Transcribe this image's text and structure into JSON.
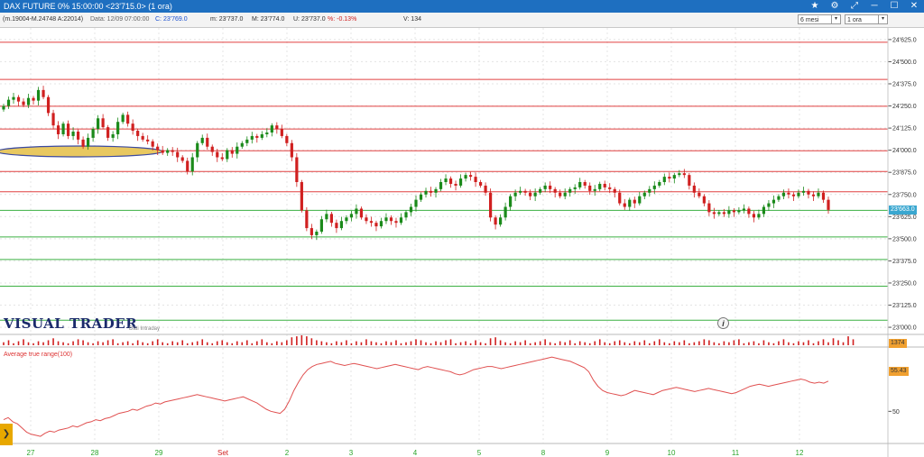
{
  "window": {
    "title": "DAX FUTURE 0%  15:00:00   <23'715.0>  (1 ora)",
    "buttons": [
      "★",
      "⚙",
      "⤢",
      "─",
      "☐",
      "✕"
    ]
  },
  "infobar": {
    "id": "(m.19004-M.24748 A:22014)",
    "data": "Data: 12/09 07:00:00",
    "close": "C: 23'769.0",
    "min": "m: 23'737.0",
    "max": "M: 23'774.0",
    "last": "U: 23'737.0",
    "pct": "%: -0.13%",
    "volume": "V: 134",
    "period": "6 mesi",
    "interval": "1 ora"
  },
  "brand": {
    "name": "VISUAL TRADER",
    "sub": "Dati Intraday"
  },
  "atr": {
    "label": "Average true range(100)",
    "value": "55.43",
    "tick": "50"
  },
  "volume_tag": "1374",
  "last_price_tag": "23'663.0",
  "colors": {
    "up": "#1a8a1a",
    "down": "#d02020",
    "resistance": "#e04040",
    "support": "#3cb043",
    "highlight": "#e8c860"
  },
  "chart_data": [
    {
      "type": "candlestick",
      "title": "DAX FUTURE 0%",
      "ylim": [
        22980,
        24660
      ],
      "y_ticks": [
        "24'625.0",
        "24'500.0",
        "24'375.0",
        "24'250.0",
        "24'125.0",
        "24'000.0",
        "23'875.0",
        "23'750.0",
        "23'625.0",
        "23'500.0",
        "23'375.0",
        "23'250.0",
        "23'125.0",
        "23'000.0"
      ],
      "x_labels": [
        "27",
        "28",
        "29",
        "Set",
        "2",
        "3",
        "4",
        "5",
        "8",
        "9",
        "10",
        "11",
        "12"
      ],
      "resistance_lines": [
        24610,
        24400,
        24248,
        24120,
        23997,
        23880,
        23765
      ],
      "support_lines": [
        23660,
        23510,
        23383,
        23232,
        23040
      ],
      "closes": [
        24250,
        24285,
        24300,
        24275,
        24255,
        24295,
        24280,
        24340,
        24300,
        24210,
        24140,
        24090,
        24150,
        24080,
        24105,
        24060,
        24020,
        24070,
        24120,
        24180,
        24130,
        24070,
        24090,
        24160,
        24200,
        24150,
        24110,
        24080,
        24060,
        24050,
        24020,
        24000,
        23985,
        24000,
        23990,
        23960,
        23940,
        23880,
        23960,
        24040,
        24070,
        24020,
        23990,
        23960,
        23950,
        24000,
        23980,
        24020,
        24040,
        24060,
        24080,
        24070,
        24090,
        24100,
        24140,
        24120,
        24080,
        24040,
        23960,
        23820,
        23660,
        23560,
        23520,
        23540,
        23610,
        23640,
        23590,
        23560,
        23600,
        23620,
        23640,
        23670,
        23620,
        23600,
        23590,
        23570,
        23600,
        23620,
        23600,
        23590,
        23620,
        23650,
        23680,
        23720,
        23750,
        23770,
        23760,
        23780,
        23820,
        23840,
        23810,
        23800,
        23840,
        23860,
        23850,
        23820,
        23800,
        23760,
        23620,
        23580,
        23620,
        23680,
        23740,
        23760,
        23770,
        23760,
        23740,
        23760,
        23780,
        23800,
        23780,
        23760,
        23740,
        23760,
        23780,
        23790,
        23820,
        23800,
        23770,
        23780,
        23810,
        23790,
        23780,
        23760,
        23700,
        23680,
        23720,
        23700,
        23740,
        23760,
        23780,
        23800,
        23820,
        23850,
        23840,
        23860,
        23870,
        23860,
        23800,
        23760,
        23740,
        23700,
        23650,
        23640,
        23650,
        23640,
        23660,
        23650,
        23660,
        23670,
        23640,
        23620,
        23640,
        23680,
        23700,
        23720,
        23740,
        23760,
        23750,
        23740,
        23760,
        23770,
        23750,
        23740,
        23760,
        23720,
        23663
      ],
      "volumes": [
        3,
        5,
        2,
        4,
        6,
        3,
        2,
        4,
        3,
        5,
        7,
        4,
        3,
        2,
        4,
        6,
        5,
        3,
        2,
        4,
        3,
        5,
        6,
        2,
        3,
        4,
        2,
        5,
        3,
        2,
        4,
        6,
        3,
        2,
        4,
        3,
        5,
        2,
        3,
        4,
        6,
        3,
        2,
        4,
        5,
        3,
        2,
        4,
        3,
        5,
        2,
        4,
        6,
        3,
        2,
        4,
        3,
        5,
        8,
        9,
        10,
        9,
        7,
        5,
        4,
        3,
        2,
        4,
        3,
        5,
        2,
        4,
        3,
        6,
        4,
        3,
        2,
        4,
        3,
        5,
        2,
        3,
        4,
        6,
        5,
        3,
        2,
        4,
        3,
        5,
        6,
        2,
        3,
        4,
        2,
        5,
        3,
        2,
        7,
        8,
        5,
        3,
        2,
        4,
        3,
        5,
        2,
        3,
        4,
        6,
        3,
        2,
        4,
        3,
        5,
        2,
        4,
        3,
        2,
        4,
        6,
        3,
        2,
        4,
        5,
        3,
        2,
        4,
        3,
        5,
        2,
        4,
        6,
        3,
        2,
        4,
        3,
        5,
        2,
        3,
        4,
        6,
        5,
        3,
        2,
        4,
        3,
        5,
        6,
        2,
        3,
        4,
        2,
        5,
        3,
        2,
        4,
        6,
        3,
        2,
        4,
        3,
        5,
        2,
        4,
        6,
        3,
        7,
        5,
        3,
        9,
        6
      ]
    },
    {
      "type": "line",
      "title": "Average true range(100)",
      "ylim": [
        20,
        110
      ],
      "y_ticks": [
        "50"
      ],
      "values": [
        42,
        44,
        40,
        38,
        34,
        30,
        28,
        27,
        26,
        29,
        31,
        30,
        32,
        33,
        34,
        36,
        35,
        37,
        39,
        40,
        42,
        41,
        43,
        44,
        46,
        48,
        49,
        50,
        52,
        51,
        53,
        55,
        56,
        58,
        57,
        59,
        60,
        61,
        62,
        63,
        64,
        65,
        66,
        65,
        64,
        63,
        62,
        61,
        60,
        61,
        62,
        63,
        64,
        62,
        60,
        58,
        55,
        52,
        50,
        49,
        48,
        52,
        60,
        70,
        78,
        85,
        90,
        93,
        95,
        96,
        97,
        98,
        96,
        95,
        94,
        95,
        96,
        95,
        94,
        93,
        92,
        91,
        92,
        93,
        94,
        95,
        94,
        93,
        92,
        91,
        90,
        92,
        93,
        92,
        91,
        90,
        89,
        88,
        86,
        85,
        86,
        88,
        90,
        91,
        92,
        93,
        93,
        92,
        91,
        92,
        93,
        94,
        95,
        96,
        97,
        98,
        99,
        100,
        101,
        102,
        101,
        100,
        99,
        98,
        96,
        94,
        92,
        88,
        80,
        74,
        70,
        68,
        67,
        66,
        65,
        66,
        68,
        70,
        69,
        68,
        67,
        66,
        68,
        70,
        71,
        72,
        73,
        72,
        71,
        70,
        69,
        70,
        71,
        72,
        71,
        70,
        69,
        68,
        67,
        68,
        70,
        72,
        74,
        75,
        76,
        75,
        74,
        75,
        76,
        77,
        78,
        79,
        80,
        81,
        80,
        78,
        77,
        78,
        77,
        79
      ]
    }
  ]
}
